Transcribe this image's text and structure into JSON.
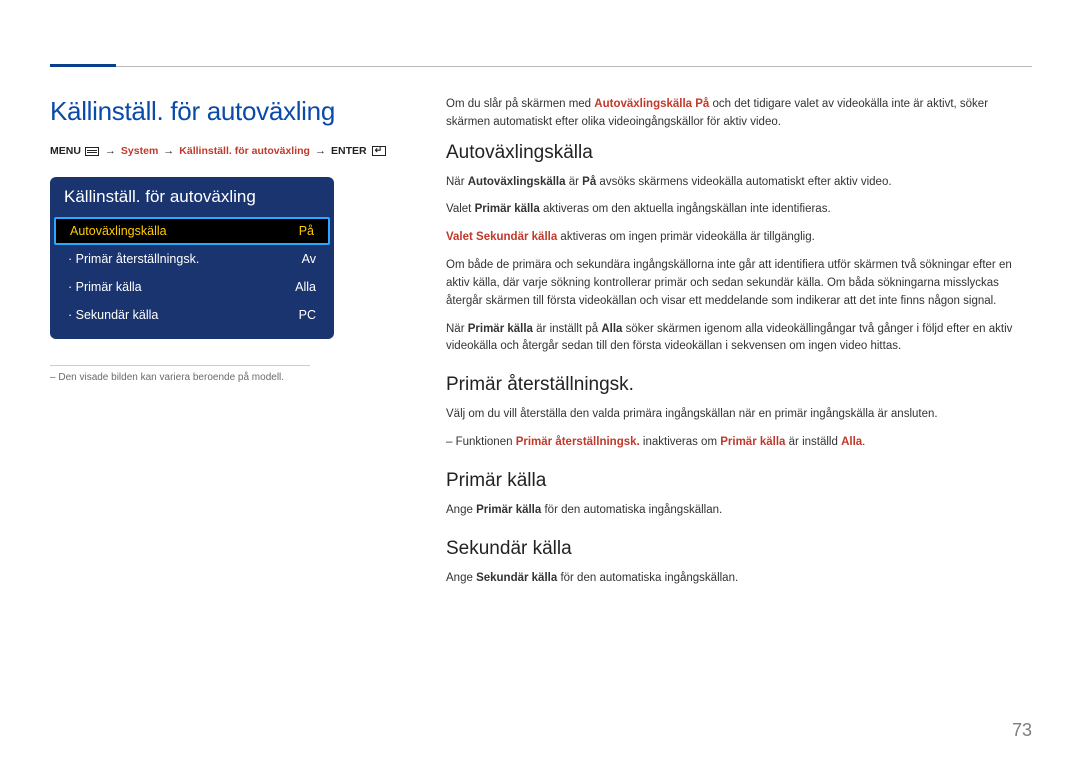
{
  "page_number": "73",
  "left": {
    "page_title": "Källinställ. för autoväxling",
    "breadcrumb": {
      "menu": "MENU",
      "system": "System",
      "setting": "Källinställ. för autoväxling",
      "enter": "ENTER"
    },
    "panel": {
      "title": "Källinställ. för autoväxling",
      "rows": [
        {
          "label": "Autoväxlingskälla",
          "value": "På",
          "selected": true
        },
        {
          "label": "Primär återställningsk.",
          "value": "Av",
          "selected": false
        },
        {
          "label": "Primär källa",
          "value": "Alla",
          "selected": false
        },
        {
          "label": "Sekundär källa",
          "value": "PC",
          "selected": false
        }
      ]
    },
    "footnote": "Den visade bilden kan variera beroende på modell."
  },
  "right": {
    "intro_pre": "Om du slår på skärmen med ",
    "intro_bold": "Autoväxlingskälla På",
    "intro_post": " och det tidigare valet av videokälla inte är aktivt, söker skärmen automatiskt efter olika videoingångskällor för aktiv video.",
    "h1": "Autoväxlingskälla",
    "p1_pre": "När ",
    "p1_b1": "Autoväxlingskälla",
    "p1_mid1": " är ",
    "p1_b2": "På",
    "p1_post": " avsöks skärmens videokälla automatiskt efter aktiv video.",
    "p2_pre": "Valet ",
    "p2_b": "Primär källa",
    "p2_post": " aktiveras om den aktuella ingångskällan inte identifieras.",
    "p3_b": "Valet Sekundär källa",
    "p3_post": " aktiveras om ingen primär videokälla är tillgänglig.",
    "p4": "Om både de primära och sekundära ingångskällorna inte går att identifiera utför skärmen två sökningar efter en aktiv källa, där varje sökning kontrollerar primär och sedan sekundär källa. Om båda sökningarna misslyckas återgår skärmen till första videokällan och visar ett meddelande som indikerar att det inte finns någon signal.",
    "p5_pre": "När ",
    "p5_b1": "Primär källa",
    "p5_mid1": " är inställt på ",
    "p5_b2": "Alla",
    "p5_post": " söker skärmen igenom alla videokällingångar två gånger i följd efter en aktiv videokälla och återgår sedan till den första videokällan i sekvensen om ingen video hittas.",
    "h2": "Primär återställningsk.",
    "p6": "Välj om du vill återställa den valda primära ingångskällan när en primär ingångskälla är ansluten.",
    "note_pre": "Funktionen ",
    "note_b1": "Primär återställningsk.",
    "note_mid1": " inaktiveras om ",
    "note_b2": "Primär källa",
    "note_mid2": " är inställd ",
    "note_b3": "Alla",
    "note_post": ".",
    "h3": "Primär källa",
    "p7_pre": "Ange ",
    "p7_b": "Primär källa",
    "p7_post": " för den automatiska ingångskällan.",
    "h4": "Sekundär källa",
    "p8_pre": "Ange ",
    "p8_b": "Sekundär källa",
    "p8_post": " för den automatiska ingångskällan."
  }
}
